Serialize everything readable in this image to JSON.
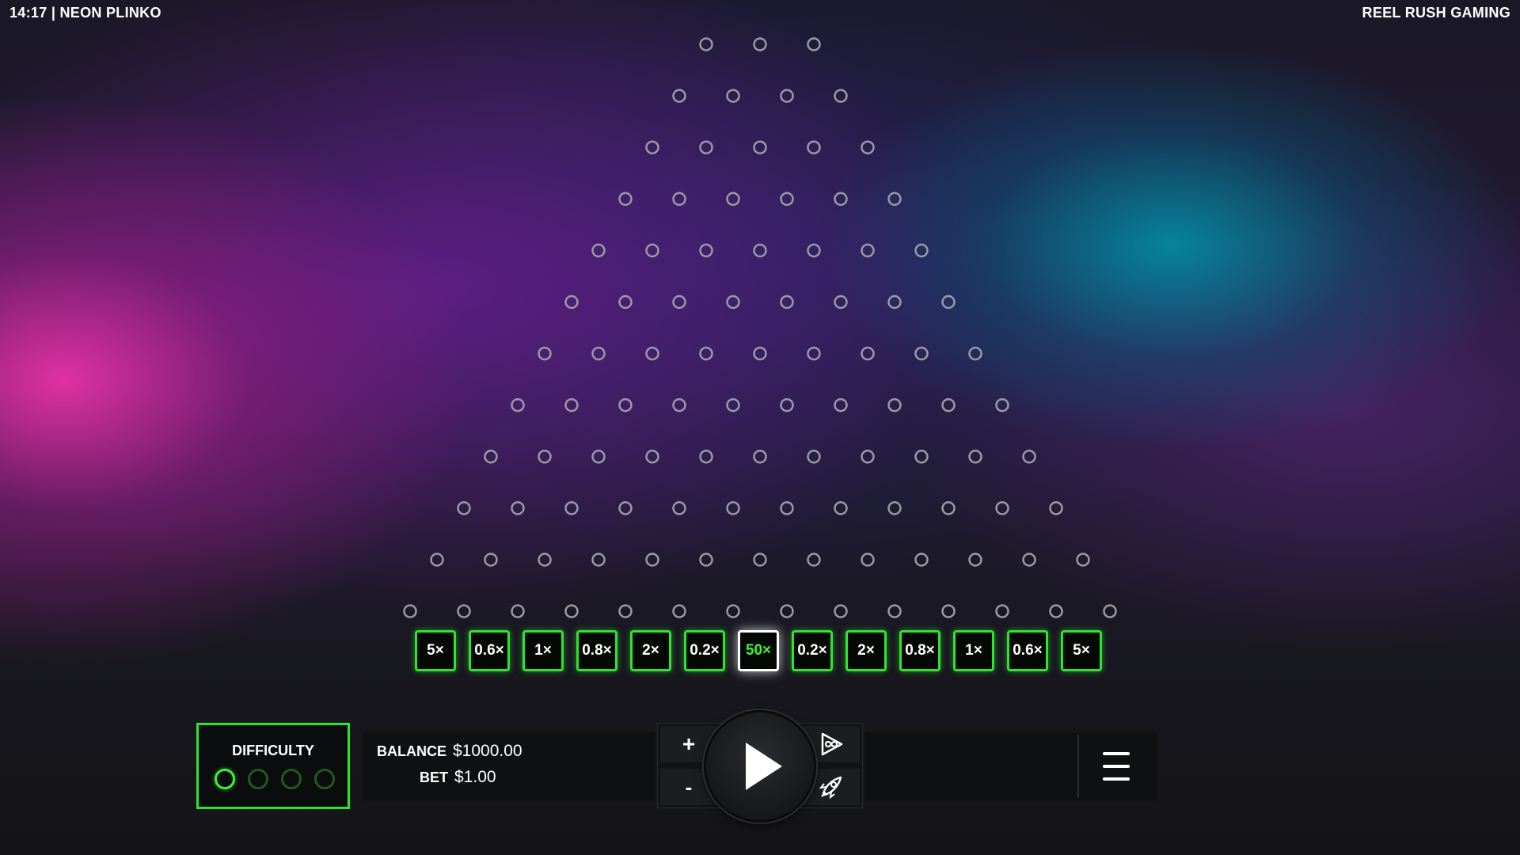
{
  "header": {
    "left_text": "14:17 | NEON PLINKO",
    "right_text": "REEL RUSH GAMING"
  },
  "board": {
    "peg_rows": [
      3,
      4,
      5,
      6,
      7,
      8,
      9,
      10,
      11,
      12,
      13,
      14
    ],
    "multipliers": [
      "5×",
      "0.6×",
      "1×",
      "0.8×",
      "2×",
      "0.2×",
      "50×",
      "0.2×",
      "2×",
      "0.8×",
      "1×",
      "0.6×",
      "5×"
    ],
    "active_slot_index": 6
  },
  "difficulty": {
    "label": "DIFFICULTY",
    "levels": 4,
    "selected_index": 0
  },
  "wallet": {
    "balance_label": "BALANCE",
    "balance_value": "$1000.00",
    "bet_label": "BET",
    "bet_value": "$1.00"
  },
  "controls": {
    "increase_label": "+",
    "decrease_label": "-",
    "autoplay_icon": "infinity-play-icon",
    "turbo_icon": "rocket-icon",
    "play_icon": "play-icon",
    "menu_icon": "hamburger-menu-icon"
  },
  "colors": {
    "accent_green": "#2ee52e",
    "peg_color": "#9a9aa2"
  }
}
